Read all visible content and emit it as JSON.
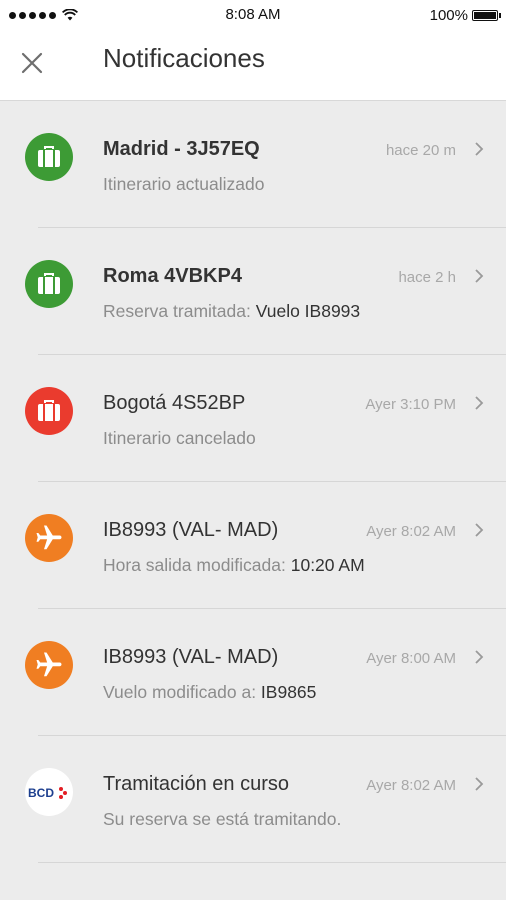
{
  "status_bar": {
    "time": "8:08 AM",
    "battery": "100%"
  },
  "header": {
    "title": "Notificaciones",
    "close_icon": "close-icon"
  },
  "notifications": [
    {
      "icon": "luggage-icon",
      "icon_color": "#3d9b35",
      "title": "Madrid - 3J57EQ",
      "title_bold": true,
      "time": "hace 20 m",
      "subtitle": "Itinerario actualizado",
      "subtitle_value": ""
    },
    {
      "icon": "luggage-icon",
      "icon_color": "#3d9b35",
      "title": "Roma 4VBKP4",
      "title_bold": true,
      "time": "hace 2 h",
      "subtitle": "Reserva tramitada: ",
      "subtitle_value": "Vuelo IB8993"
    },
    {
      "icon": "luggage-icon",
      "icon_color": "#ea3b2e",
      "title": "Bogotá 4S52BP",
      "title_bold": false,
      "time": "Ayer 3:10 PM",
      "subtitle": "Itinerario cancelado",
      "subtitle_value": ""
    },
    {
      "icon": "airplane-icon",
      "icon_color": "#f07e22",
      "title": "IB8993 (VAL- MAD)",
      "title_bold": false,
      "time": "Ayer 8:02 AM",
      "subtitle": "Hora salida modificada: ",
      "subtitle_value": "10:20 AM"
    },
    {
      "icon": "airplane-icon",
      "icon_color": "#f07e22",
      "title": "IB8993 (VAL- MAD)",
      "title_bold": false,
      "time": "Ayer 8:00 AM",
      "subtitle": "Vuelo modificado a: ",
      "subtitle_value": "IB9865"
    },
    {
      "icon": "bcd-logo-icon",
      "icon_color": "#ffffff",
      "logo_text": "BCD",
      "title": "Tramitación en curso",
      "title_bold": false,
      "time": "Ayer 8:02 AM",
      "subtitle": "Su reserva se está tramitando.",
      "subtitle_value": ""
    }
  ]
}
